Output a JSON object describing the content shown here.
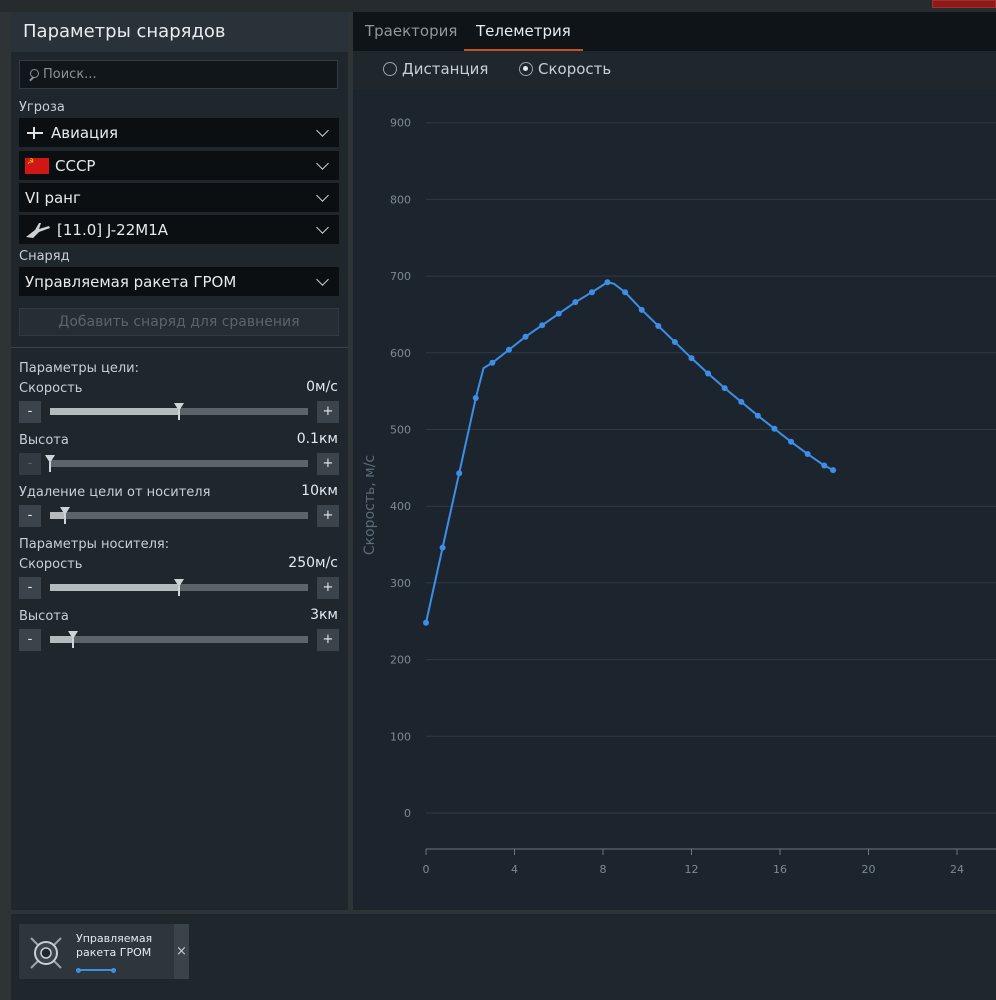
{
  "left": {
    "title": "Параметры снарядов",
    "search_placeholder": "Поиск...",
    "threat_label": "Угроза",
    "threat_type": "Авиация",
    "nation": "СССР",
    "rank": "VI ранг",
    "vehicle": "[11.0] J-22M1A",
    "shell_label": "Снаряд",
    "shell": "Управляемая ракета ГРОМ",
    "add_compare": "Добавить снаряд для сравнения",
    "target_params_label": "Параметры цели:",
    "target_speed_label": "Скорость",
    "target_speed_value": "0м/с",
    "target_speed_fraction": 0.5,
    "target_alt_label": "Высота",
    "target_alt_value": "0.1км",
    "target_alt_fraction": 0.0,
    "distance_label": "Удаление цели от носителя",
    "distance_value": "10км",
    "distance_fraction": 0.06,
    "carrier_params_label": "Параметры носителя:",
    "carrier_speed_label": "Скорость",
    "carrier_speed_value": "250м/с",
    "carrier_speed_fraction": 0.5,
    "carrier_alt_label": "Высота",
    "carrier_alt_value": "3км",
    "carrier_alt_fraction": 0.09,
    "minus": "-",
    "plus": "+"
  },
  "tabs": [
    "Траектория",
    "Телеметрия"
  ],
  "active_tab": 1,
  "radios": [
    "Дистанция",
    "Скорость"
  ],
  "checked_radio": 1,
  "bottom": {
    "card_title": "Управляемая ракета ГРОМ",
    "close": "×"
  },
  "chart_data": {
    "type": "line",
    "title": "",
    "xlabel": "",
    "ylabel": "Скорость, м/с",
    "xlim": [
      0,
      25
    ],
    "ylim": [
      -50,
      950
    ],
    "x_ticks": [
      0,
      4,
      8,
      12,
      16,
      20,
      24
    ],
    "y_ticks": [
      0,
      100,
      200,
      300,
      400,
      500,
      600,
      700,
      800,
      900
    ],
    "grid": "horizontal",
    "color": "#3d8ee8",
    "series": [
      {
        "x": [
          0,
          0.75,
          1.5,
          2.25,
          2.6,
          3.0,
          3.75,
          4.5,
          5.25,
          6.0,
          6.75,
          7.5,
          8.2,
          8.5,
          9.0,
          9.75,
          10.5,
          11.25,
          12.0,
          12.75,
          13.5,
          14.25,
          15.0,
          15.75,
          16.5,
          17.25,
          18.0,
          18.4
        ],
        "values": [
          248,
          346,
          443,
          541,
          580,
          587,
          604,
          621,
          636,
          651,
          666,
          679,
          692,
          690,
          679,
          656,
          635,
          614,
          593,
          573,
          554,
          536,
          518,
          501,
          484,
          468,
          453,
          447
        ]
      }
    ]
  }
}
